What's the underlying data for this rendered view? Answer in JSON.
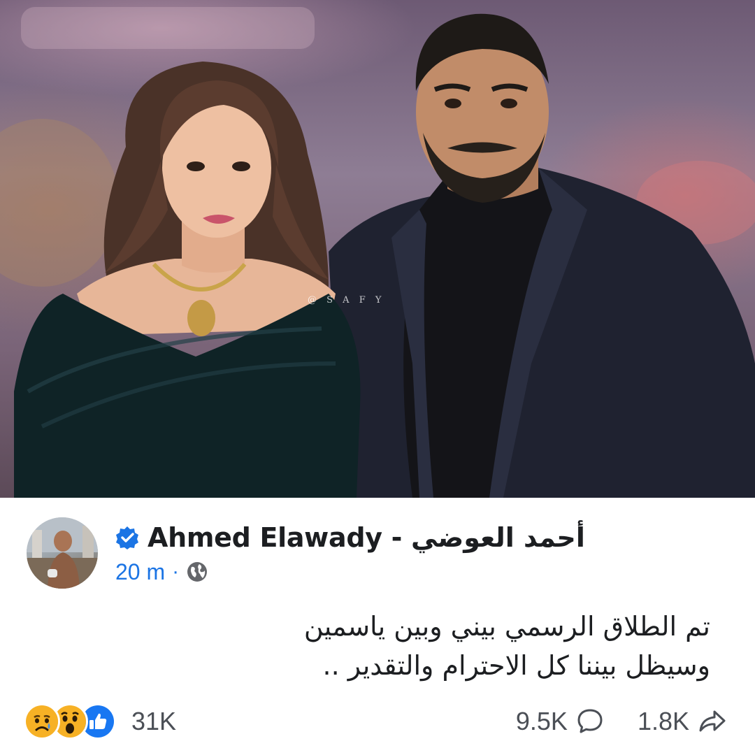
{
  "photo": {
    "watermark": "@ S A F Y"
  },
  "post": {
    "author": "Ahmed Elawady - أحمد العوضي",
    "time": "20 m",
    "separator": "·",
    "text_lines": [
      "تم الطلاق الرسمي بيني وبين ياسمين",
      "وسيظل بيننا كل الاحترام والتقدير .."
    ]
  },
  "footer": {
    "reactions": [
      "sad-icon",
      "wow-icon",
      "like-icon"
    ],
    "reaction_count": "31K",
    "comment_count": "9.5K",
    "share_count": "1.8K"
  },
  "colors": {
    "accent": "#1b74e4",
    "text": "#1c1e21",
    "muted": "#4b4f56"
  }
}
